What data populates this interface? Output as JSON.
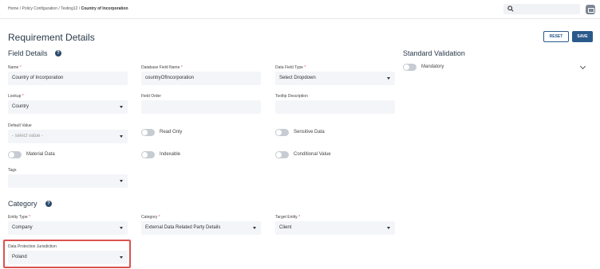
{
  "breadcrumb": {
    "items": [
      "Home",
      "Policy Configuration",
      "Testing12"
    ],
    "current": "Country of Incorporation"
  },
  "header": {
    "title": "Requirement Details",
    "reset_label": "RESET",
    "save_label": "SAVE"
  },
  "field_details": {
    "heading": "Field Details",
    "name": {
      "label": "Name",
      "value": "Country of Incorporation"
    },
    "db_field_name": {
      "label": "Database Field Name",
      "value": "countryOfIncorporation"
    },
    "data_field_type": {
      "label": "Data Field Type",
      "value": "Select Dropdown"
    },
    "lookup": {
      "label": "Lookup",
      "value": "Country"
    },
    "field_order": {
      "label": "Field Order",
      "value": ""
    },
    "tooltip": {
      "label": "Tooltip Description",
      "value": ""
    },
    "default_value": {
      "label": "Default Value",
      "placeholder": "- select value -"
    },
    "tags": {
      "label": "Tags",
      "value": ""
    },
    "toggles": {
      "read_only": "Read Only",
      "sensitive_data": "Sensitive Data",
      "material_data": "Material Data",
      "indexable": "Indexable",
      "conditional_value": "Conditional Value"
    }
  },
  "standard_validation": {
    "heading": "Standard Validation",
    "mandatory": "Mandatory"
  },
  "category": {
    "heading": "Category",
    "entity_type": {
      "label": "Entity Type",
      "value": "Company"
    },
    "category": {
      "label": "Category",
      "value": "External Data Related Party Details"
    },
    "target_entity": {
      "label": "Target Entity",
      "value": "Client"
    },
    "data_protection": {
      "label": "Data Protection Jurisdiction",
      "value": "Poland"
    }
  },
  "colors": {
    "accent": "#2a5a8a",
    "highlight": "#d9534f",
    "field_bg": "#f3f5f8"
  }
}
